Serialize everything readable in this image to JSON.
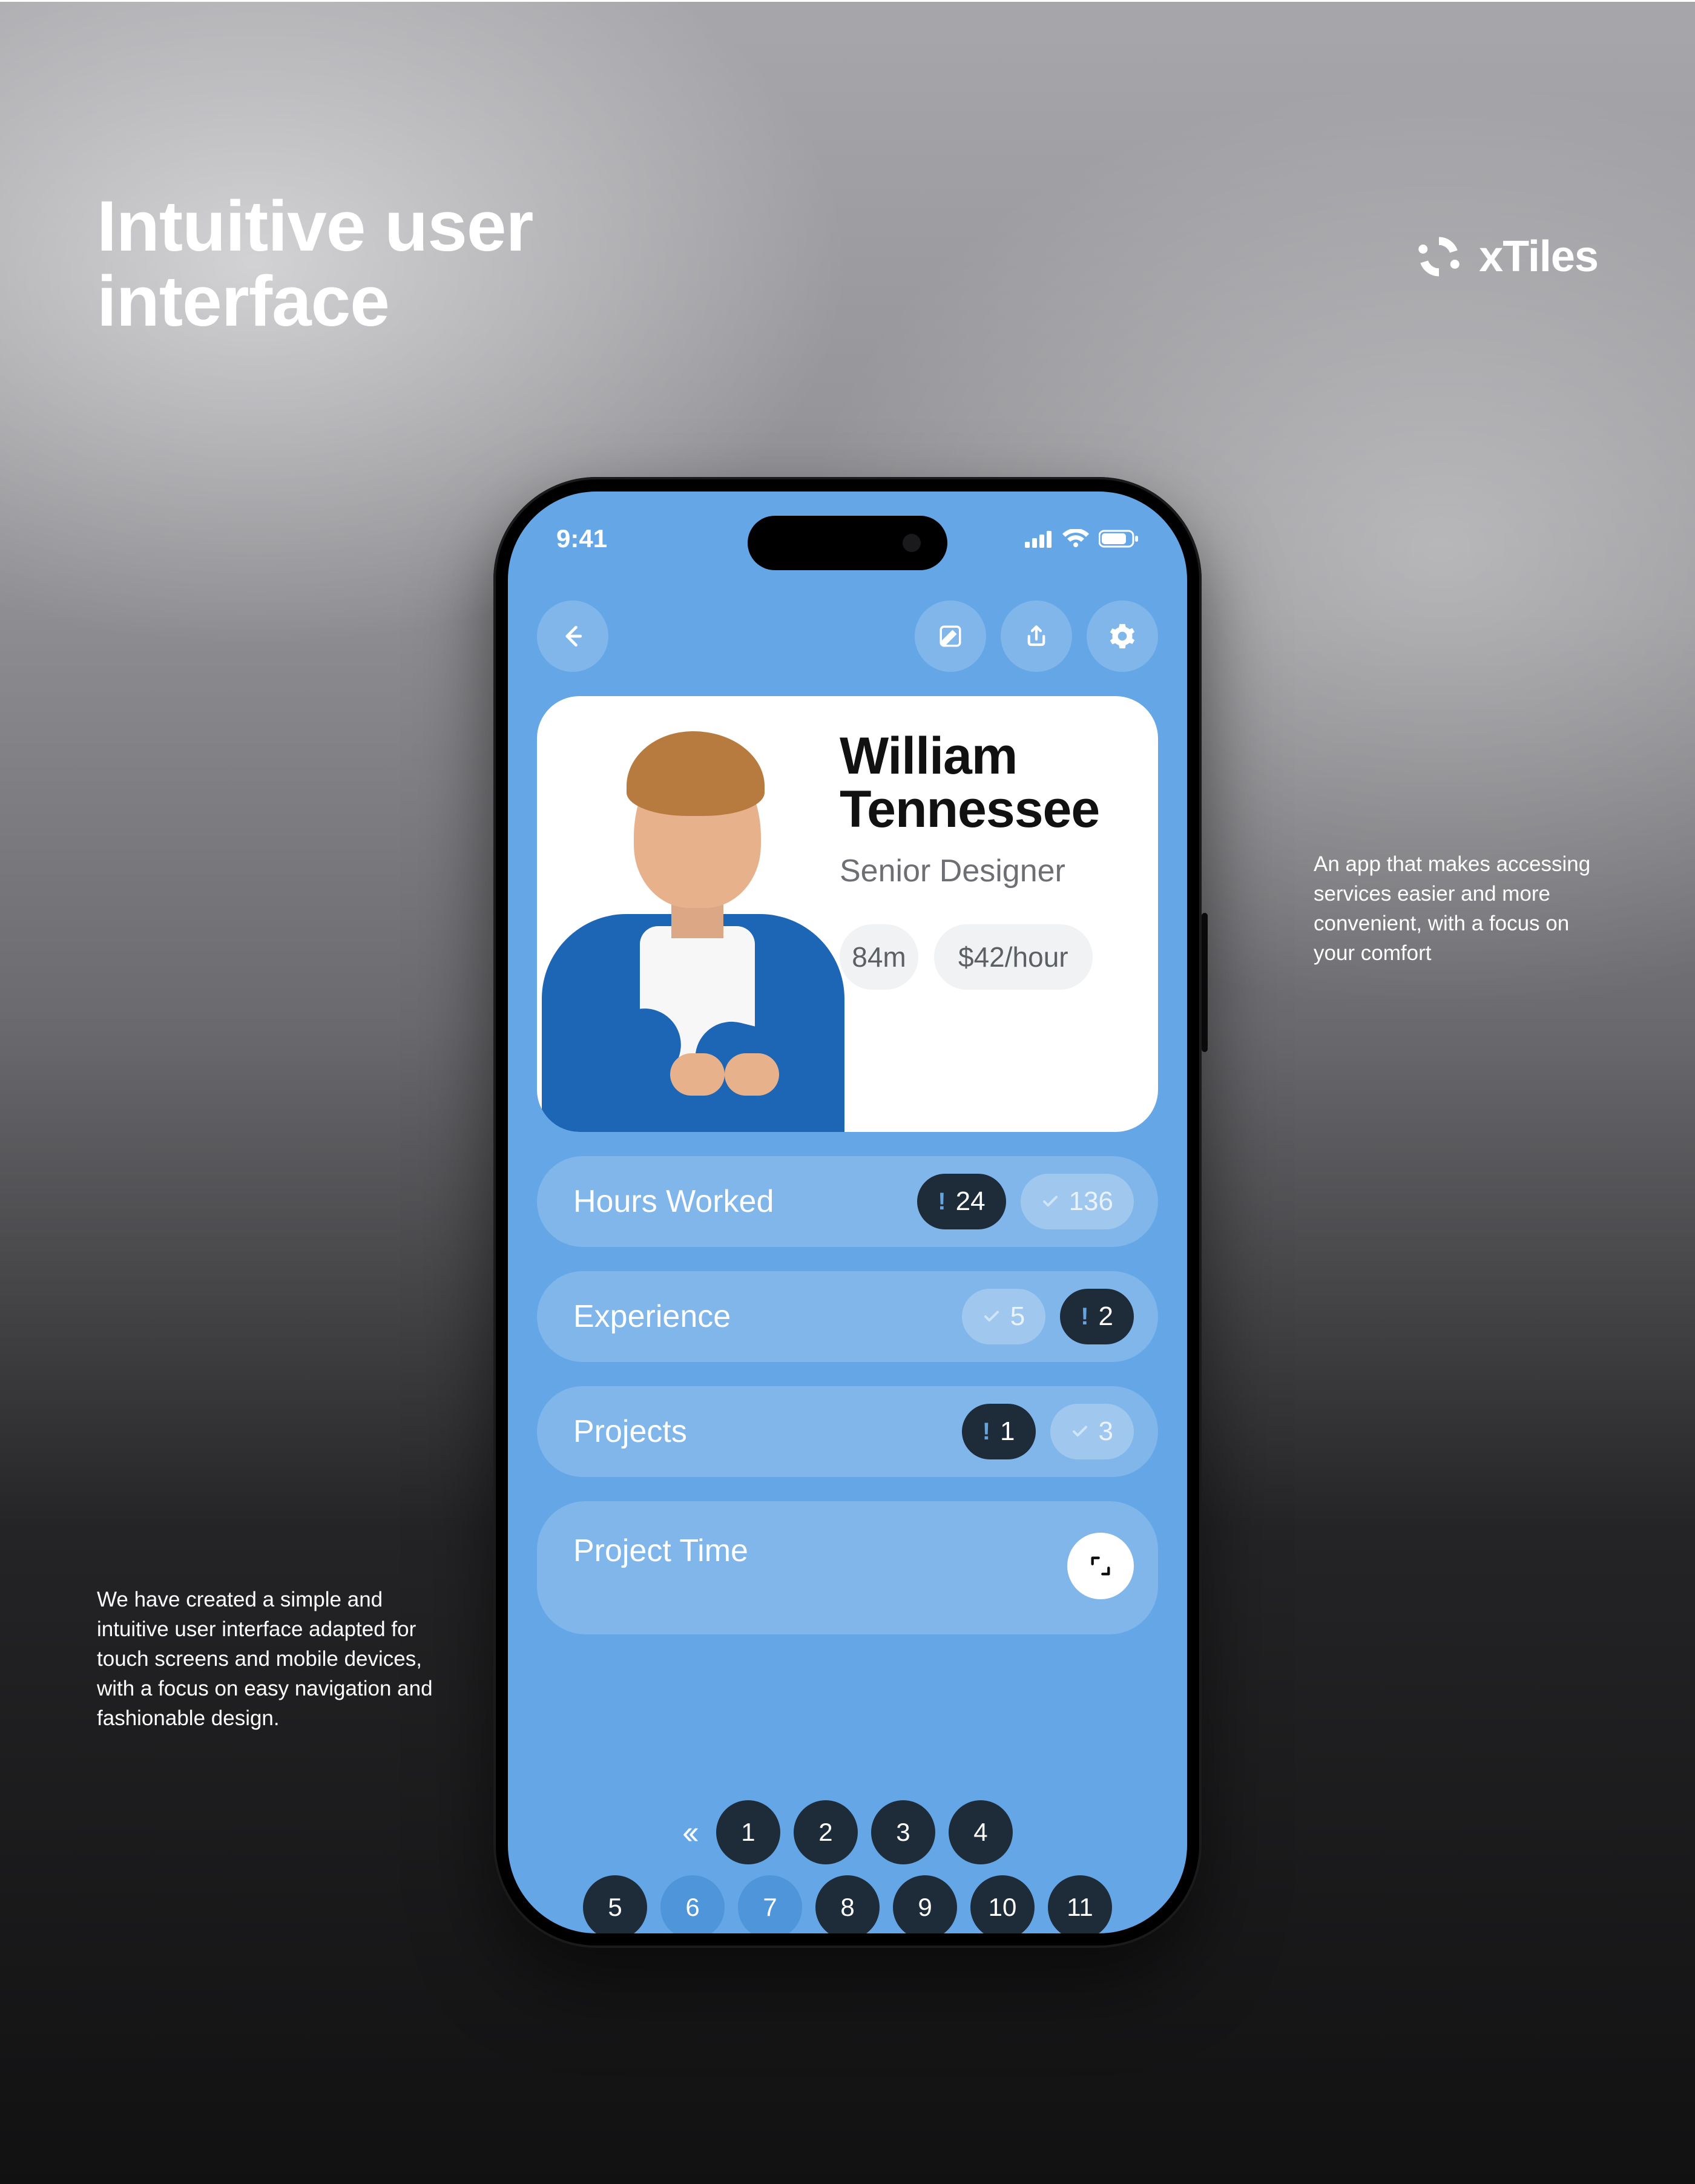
{
  "page": {
    "headline_line1": "Intuitive user",
    "headline_line2": "interface",
    "brand": "xTiles",
    "callout_right": "An app that makes accessing services easier and more convenient, with a focus on your comfort",
    "callout_left": "We have created a simple and intuitive user interface adapted for touch screens and mobile devices, with a focus on easy navigation and fashionable design."
  },
  "status": {
    "time": "9:41"
  },
  "profile": {
    "name_line1": "William",
    "name_line2": "Tennessee",
    "role": "Senior Designer",
    "chip1": "84m",
    "chip2": "$42/hour"
  },
  "rows": {
    "hours_label": "Hours Worked",
    "hours_v1": "24",
    "hours_v2": "136",
    "exp_label": "Experience",
    "exp_v1": "5",
    "exp_v2": "2",
    "proj_label": "Projects",
    "proj_v1": "1",
    "proj_v2": "3",
    "time_label": "Project Time"
  },
  "pager": {
    "top": [
      "1",
      "2",
      "3",
      "4"
    ],
    "bottom": [
      "5",
      "6",
      "7",
      "8",
      "9",
      "10",
      "11"
    ]
  }
}
